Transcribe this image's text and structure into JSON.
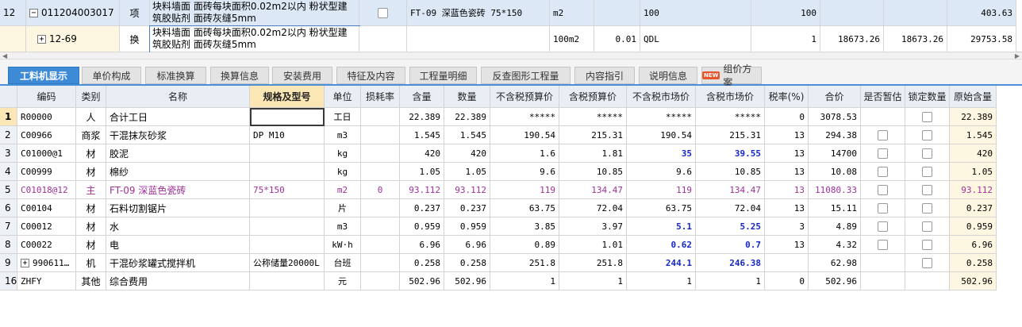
{
  "top_rows": [
    {
      "index": "12",
      "code": "011204003017",
      "type": "项",
      "desc": "块料墙面 面砖每块面积0.02m2以内 粉状型建筑胶贴剂 面砖灰缝5mm",
      "spec": "FT-09 深蓝色瓷砖 75*150",
      "unit": "m2",
      "qty": "",
      "expr": "100",
      "amount": "100",
      "p1": "",
      "p2": "",
      "total": "403.63",
      "expander": "−"
    },
    {
      "index": "",
      "code": "12-69",
      "type": "换",
      "desc": "块料墙面 面砖每块面积0.02m2以内 粉状型建筑胶贴剂 面砖灰缝5mm",
      "spec": "",
      "unit": "100m2",
      "qty": "0.01",
      "expr": "QDL",
      "amount": "1",
      "p1": "18673.26",
      "p2": "18673.26",
      "total": "29753.58",
      "expander": "+"
    }
  ],
  "tabs": [
    {
      "label": "工料机显示",
      "active": true
    },
    {
      "label": "单价构成"
    },
    {
      "label": "标准换算"
    },
    {
      "label": "换算信息"
    },
    {
      "label": "安装费用"
    },
    {
      "label": "特征及内容"
    },
    {
      "label": "工程量明细"
    },
    {
      "label": "反查图形工程量"
    },
    {
      "label": "内容指引"
    },
    {
      "label": "说明信息"
    },
    {
      "label": "组价方案",
      "badge": "NEW"
    }
  ],
  "columns": [
    "编码",
    "类别",
    "名称",
    "规格及型号",
    "单位",
    "损耗率",
    "含量",
    "数量",
    "不含税预算价",
    "含税预算价",
    "不含税市场价",
    "含税市场价",
    "税率(%)",
    "合价",
    "是否暂估",
    "锁定数量",
    "原始含量"
  ],
  "rows": [
    {
      "rn": "1",
      "code": "R00000",
      "cat": "人",
      "name": "合计工日",
      "spec": "",
      "unit": "工日",
      "loss": "",
      "content": "22.389",
      "qty": "22.389",
      "p1": "*****",
      "p2": "*****",
      "p3": "*****",
      "p4": "*****",
      "tax": "0",
      "total": "3078.53",
      "est": false,
      "lock": true,
      "orig": "22.389"
    },
    {
      "rn": "2",
      "code": "C00966",
      "cat": "商浆",
      "name": "干混抹灰砂浆",
      "spec": "DP M10",
      "unit": "m3",
      "loss": "",
      "content": "1.545",
      "qty": "1.545",
      "p1": "190.54",
      "p2": "215.31",
      "p3": "190.54",
      "p4": "215.31",
      "tax": "13",
      "total": "294.38",
      "est": true,
      "lock": true,
      "orig": "1.545"
    },
    {
      "rn": "3",
      "code": "C01000@1",
      "cat": "材",
      "name": "胶泥",
      "spec": "",
      "unit": "kg",
      "loss": "",
      "content": "420",
      "qty": "420",
      "p1": "1.6",
      "p2": "1.81",
      "p3": "35",
      "p4": "39.55",
      "tax": "13",
      "total": "14700",
      "est": true,
      "lock": true,
      "orig": "420",
      "blue": true
    },
    {
      "rn": "4",
      "code": "C00999",
      "cat": "材",
      "name": "棉纱",
      "spec": "",
      "unit": "kg",
      "loss": "",
      "content": "1.05",
      "qty": "1.05",
      "p1": "9.6",
      "p2": "10.85",
      "p3": "9.6",
      "p4": "10.85",
      "tax": "13",
      "total": "10.08",
      "est": true,
      "lock": true,
      "orig": "1.05"
    },
    {
      "rn": "5",
      "code": "C01018@12",
      "cat": "主",
      "name": "FT-09 深蓝色瓷砖",
      "spec": "75*150",
      "unit": "m2",
      "loss": "0",
      "content": "93.112",
      "qty": "93.112",
      "p1": "119",
      "p2": "134.47",
      "p3": "119",
      "p4": "134.47",
      "tax": "13",
      "total": "11080.33",
      "est": true,
      "lock": true,
      "orig": "93.112",
      "purple": true
    },
    {
      "rn": "6",
      "code": "C00104",
      "cat": "材",
      "name": "石料切割锯片",
      "spec": "",
      "unit": "片",
      "loss": "",
      "content": "0.237",
      "qty": "0.237",
      "p1": "63.75",
      "p2": "72.04",
      "p3": "63.75",
      "p4": "72.04",
      "tax": "13",
      "total": "15.11",
      "est": true,
      "lock": true,
      "orig": "0.237"
    },
    {
      "rn": "7",
      "code": "C00012",
      "cat": "材",
      "name": "水",
      "spec": "",
      "unit": "m3",
      "loss": "",
      "content": "0.959",
      "qty": "0.959",
      "p1": "3.85",
      "p2": "3.97",
      "p3": "5.1",
      "p4": "5.25",
      "tax": "3",
      "total": "4.89",
      "est": true,
      "lock": true,
      "orig": "0.959",
      "blue": true
    },
    {
      "rn": "8",
      "code": "C00022",
      "cat": "材",
      "name": "电",
      "spec": "",
      "unit": "kW·h",
      "loss": "",
      "content": "6.96",
      "qty": "6.96",
      "p1": "0.89",
      "p2": "1.01",
      "p3": "0.62",
      "p4": "0.7",
      "tax": "13",
      "total": "4.32",
      "est": true,
      "lock": true,
      "orig": "6.96",
      "blue": true
    },
    {
      "rn": "9",
      "code": "990611…",
      "cat": "机",
      "name": "干混砂浆罐式搅拌机",
      "spec": "公称储量20000L",
      "unit": "台班",
      "loss": "",
      "content": "0.258",
      "qty": "0.258",
      "p1": "251.8",
      "p2": "251.8",
      "p3": "244.1",
      "p4": "246.38",
      "tax": "",
      "total": "62.98",
      "est": false,
      "lock": true,
      "orig": "0.258",
      "blue": true,
      "expander": "+"
    },
    {
      "rn": "16",
      "code": "ZHFY",
      "cat": "其他",
      "name": "综合费用",
      "spec": "",
      "unit": "元",
      "loss": "",
      "content": "502.96",
      "qty": "502.96",
      "p1": "1",
      "p2": "1",
      "p3": "1",
      "p4": "1",
      "tax": "0",
      "total": "502.96",
      "est": false,
      "lock": false,
      "orig": "502.96"
    }
  ]
}
